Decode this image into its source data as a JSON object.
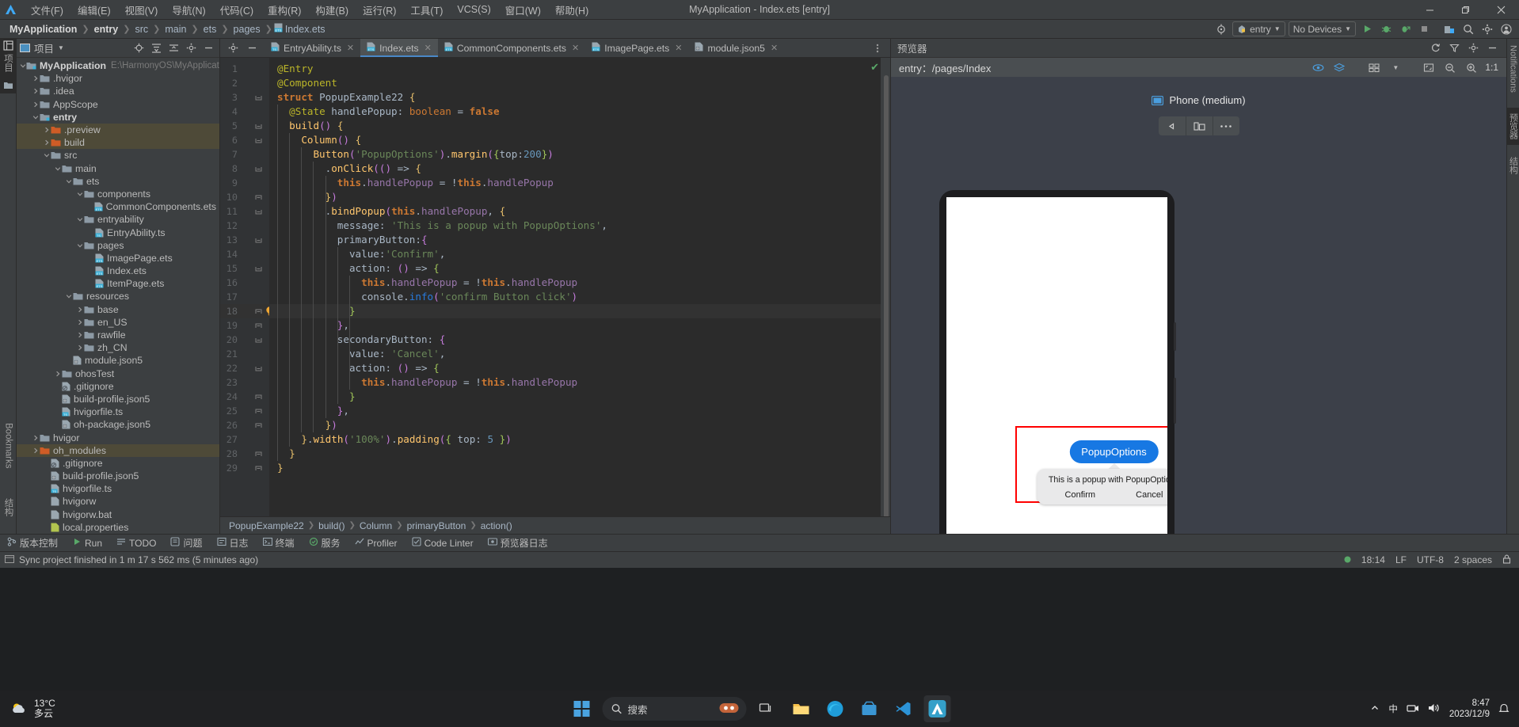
{
  "titlebar": {
    "window_title": "MyApplication - Index.ets [entry]",
    "menus": [
      "文件(F)",
      "编辑(E)",
      "视图(V)",
      "导航(N)",
      "代码(C)",
      "重构(R)",
      "构建(B)",
      "运行(R)",
      "工具(T)",
      "VCS(S)",
      "窗口(W)",
      "帮助(H)"
    ],
    "minimize": "—",
    "restore": "❐",
    "close": "✕"
  },
  "navbar": {
    "crumbs": [
      "MyApplication",
      "entry",
      "src",
      "main",
      "ets",
      "pages"
    ],
    "file": "Index.ets",
    "run_config": "entry",
    "device": "No Devices",
    "icons": [
      "target-icon",
      "run-icon",
      "debug-icon",
      "profile-icon",
      "stop-icon",
      "device-manager-icon",
      "search-icon",
      "settings-icon",
      "account-icon"
    ]
  },
  "left_strip": {
    "top_items": [
      "项目",
      "结构"
    ],
    "bottom_items": [
      "Bookmarks",
      "结构"
    ]
  },
  "project_panel": {
    "title": "项目",
    "header_icons": [
      "locate-icon",
      "expand-all-icon",
      "collapse-all-icon",
      "settings-icon",
      "hide-icon"
    ],
    "root_path": "E:\\HarmonyOS\\MyApplicatio",
    "tree": [
      {
        "label": "MyApplication",
        "depth": 0,
        "arrow": "down",
        "icon": "module-folder",
        "bold": true,
        "path": "E:\\HarmonyOS\\MyApplicatio"
      },
      {
        "label": ".hvigor",
        "depth": 1,
        "arrow": "right",
        "icon": "folder"
      },
      {
        "label": ".idea",
        "depth": 1,
        "arrow": "right",
        "icon": "folder"
      },
      {
        "label": "AppScope",
        "depth": 1,
        "arrow": "right",
        "icon": "folder"
      },
      {
        "label": "entry",
        "depth": 1,
        "arrow": "down",
        "icon": "module-folder",
        "bold": true
      },
      {
        "label": ".preview",
        "depth": 2,
        "arrow": "right",
        "icon": "folder-orange",
        "selected": true
      },
      {
        "label": "build",
        "depth": 2,
        "arrow": "right",
        "icon": "folder-orange",
        "selected": true
      },
      {
        "label": "src",
        "depth": 2,
        "arrow": "down",
        "icon": "folder"
      },
      {
        "label": "main",
        "depth": 3,
        "arrow": "down",
        "icon": "folder"
      },
      {
        "label": "ets",
        "depth": 4,
        "arrow": "down",
        "icon": "folder"
      },
      {
        "label": "components",
        "depth": 5,
        "arrow": "down",
        "icon": "folder"
      },
      {
        "label": "CommonComponents.ets",
        "depth": 6,
        "arrow": "",
        "icon": "ets-file"
      },
      {
        "label": "entryability",
        "depth": 5,
        "arrow": "down",
        "icon": "folder"
      },
      {
        "label": "EntryAbility.ts",
        "depth": 6,
        "arrow": "",
        "icon": "ts-file"
      },
      {
        "label": "pages",
        "depth": 5,
        "arrow": "down",
        "icon": "folder"
      },
      {
        "label": "ImagePage.ets",
        "depth": 6,
        "arrow": "",
        "icon": "ets-file"
      },
      {
        "label": "Index.ets",
        "depth": 6,
        "arrow": "",
        "icon": "ets-file"
      },
      {
        "label": "ItemPage.ets",
        "depth": 6,
        "arrow": "",
        "icon": "ets-file"
      },
      {
        "label": "resources",
        "depth": 4,
        "arrow": "down",
        "icon": "folder"
      },
      {
        "label": "base",
        "depth": 5,
        "arrow": "right",
        "icon": "folder"
      },
      {
        "label": "en_US",
        "depth": 5,
        "arrow": "right",
        "icon": "folder"
      },
      {
        "label": "rawfile",
        "depth": 5,
        "arrow": "right",
        "icon": "folder"
      },
      {
        "label": "zh_CN",
        "depth": 5,
        "arrow": "right",
        "icon": "folder"
      },
      {
        "label": "module.json5",
        "depth": 4,
        "arrow": "",
        "icon": "json-file"
      },
      {
        "label": "ohosTest",
        "depth": 3,
        "arrow": "right",
        "icon": "folder"
      },
      {
        "label": ".gitignore",
        "depth": 3,
        "arrow": "",
        "icon": "gitignore-file"
      },
      {
        "label": "build-profile.json5",
        "depth": 3,
        "arrow": "",
        "icon": "json-file"
      },
      {
        "label": "hvigorfile.ts",
        "depth": 3,
        "arrow": "",
        "icon": "ts-file"
      },
      {
        "label": "oh-package.json5",
        "depth": 3,
        "arrow": "",
        "icon": "json-file"
      },
      {
        "label": "hvigor",
        "depth": 1,
        "arrow": "right",
        "icon": "folder"
      },
      {
        "label": "oh_modules",
        "depth": 1,
        "arrow": "right",
        "icon": "folder-orange",
        "selected": true
      },
      {
        "label": ".gitignore",
        "depth": 2,
        "arrow": "",
        "icon": "gitignore-file"
      },
      {
        "label": "build-profile.json5",
        "depth": 2,
        "arrow": "",
        "icon": "json-file"
      },
      {
        "label": "hvigorfile.ts",
        "depth": 2,
        "arrow": "",
        "icon": "ts-file"
      },
      {
        "label": "hvigorw",
        "depth": 2,
        "arrow": "",
        "icon": "file"
      },
      {
        "label": "hvigorw.bat",
        "depth": 2,
        "arrow": "",
        "icon": "file"
      },
      {
        "label": "local.properties",
        "depth": 2,
        "arrow": "",
        "icon": "props-file"
      }
    ]
  },
  "editor": {
    "tabs": [
      {
        "label": "EntryAbility.ts",
        "icon": "ts-file",
        "active": false
      },
      {
        "label": "Index.ets",
        "icon": "ets-file",
        "active": true
      },
      {
        "label": "CommonComponents.ets",
        "icon": "ets-file",
        "active": false
      },
      {
        "label": "ImagePage.ets",
        "icon": "ets-file",
        "active": false
      },
      {
        "label": "module.json5",
        "icon": "json-file",
        "active": false
      }
    ],
    "highlighted_line": 18,
    "lines": [
      {
        "n": 1,
        "indent": 0,
        "fold": "",
        "tokens": [
          [
            "k-deco",
            "@Entry"
          ]
        ]
      },
      {
        "n": 2,
        "indent": 0,
        "fold": "",
        "tokens": [
          [
            "k-deco",
            "@Component"
          ]
        ]
      },
      {
        "n": 3,
        "indent": 0,
        "fold": "minus",
        "tokens": [
          [
            "k-kw",
            "struct "
          ],
          [
            "k-cls",
            "PopupExample22 "
          ],
          [
            "k-bracket1",
            "{"
          ]
        ]
      },
      {
        "n": 4,
        "indent": 1,
        "fold": "",
        "tokens": [
          [
            "k-deco",
            "@State "
          ],
          [
            "k-pl",
            "handlePopup"
          ],
          [
            "k-pl",
            ": "
          ],
          [
            "k-kw2",
            "boolean"
          ],
          [
            "k-pl",
            " = "
          ],
          [
            "k-kw",
            "false"
          ]
        ]
      },
      {
        "n": 5,
        "indent": 1,
        "fold": "minus",
        "tokens": [
          [
            "k-def",
            "build"
          ],
          [
            "k-bracket2",
            "()"
          ],
          [
            "k-pl",
            " "
          ],
          [
            "k-bracket1",
            "{"
          ]
        ]
      },
      {
        "n": 6,
        "indent": 2,
        "fold": "minus",
        "tokens": [
          [
            "k-fn",
            "Column"
          ],
          [
            "k-bracket2",
            "()"
          ],
          [
            "k-pl",
            " "
          ],
          [
            "k-bracket1",
            "{"
          ]
        ]
      },
      {
        "n": 7,
        "indent": 3,
        "fold": "",
        "tokens": [
          [
            "k-fn",
            "Button"
          ],
          [
            "k-bracket2",
            "("
          ],
          [
            "k-str",
            "'PopupOptions'"
          ],
          [
            "k-bracket2",
            ")"
          ],
          [
            "k-pl",
            "."
          ],
          [
            "k-fn",
            "margin"
          ],
          [
            "k-bracket2",
            "("
          ],
          [
            "k-bracket3",
            "{"
          ],
          [
            "k-pl",
            "top:"
          ],
          [
            "k-num",
            "200"
          ],
          [
            "k-bracket3",
            "}"
          ],
          [
            "k-bracket2",
            ")"
          ]
        ]
      },
      {
        "n": 8,
        "indent": 4,
        "fold": "minus",
        "tokens": [
          [
            "k-pl",
            "."
          ],
          [
            "k-fn",
            "onClick"
          ],
          [
            "k-bracket2",
            "(("
          ],
          [
            "k-bracket2",
            ")"
          ],
          [
            "k-pl",
            " => "
          ],
          [
            "k-bracket1",
            "{"
          ]
        ]
      },
      {
        "n": 9,
        "indent": 5,
        "fold": "",
        "tokens": [
          [
            "k-kw",
            "this"
          ],
          [
            "k-pl",
            "."
          ],
          [
            "k-field",
            "handlePopup"
          ],
          [
            "k-pl",
            " = !"
          ],
          [
            "k-kw",
            "this"
          ],
          [
            "k-pl",
            "."
          ],
          [
            "k-field",
            "handlePopup"
          ]
        ]
      },
      {
        "n": 10,
        "indent": 4,
        "fold": "minus-end",
        "tokens": [
          [
            "k-bracket1",
            "}"
          ],
          [
            "k-bracket2",
            ")"
          ]
        ]
      },
      {
        "n": 11,
        "indent": 4,
        "fold": "minus",
        "tokens": [
          [
            "k-pl",
            "."
          ],
          [
            "k-fn",
            "bindPopup"
          ],
          [
            "k-bracket2",
            "("
          ],
          [
            "k-kw",
            "this"
          ],
          [
            "k-pl",
            "."
          ],
          [
            "k-field",
            "handlePopup"
          ],
          [
            "k-pl",
            ", "
          ],
          [
            "k-bracket1",
            "{"
          ]
        ]
      },
      {
        "n": 12,
        "indent": 5,
        "fold": "",
        "tokens": [
          [
            "k-pl",
            "message: "
          ],
          [
            "k-str",
            "'This is a popup with PopupOptions'"
          ],
          [
            "k-pl",
            ","
          ]
        ]
      },
      {
        "n": 13,
        "indent": 5,
        "fold": "minus",
        "tokens": [
          [
            "k-pl",
            "primaryButton:"
          ],
          [
            "k-bracket2",
            "{"
          ]
        ]
      },
      {
        "n": 14,
        "indent": 6,
        "fold": "",
        "tokens": [
          [
            "k-pl",
            "value:"
          ],
          [
            "k-str",
            "'Confirm'"
          ],
          [
            "k-pl",
            ","
          ]
        ]
      },
      {
        "n": 15,
        "indent": 6,
        "fold": "minus",
        "tokens": [
          [
            "k-pl",
            "action: "
          ],
          [
            "k-bracket2",
            "()"
          ],
          [
            "k-pl",
            " => "
          ],
          [
            "k-bracket3",
            "{"
          ]
        ]
      },
      {
        "n": 16,
        "indent": 7,
        "fold": "",
        "tokens": [
          [
            "k-kw",
            "this"
          ],
          [
            "k-pl",
            "."
          ],
          [
            "k-field",
            "handlePopup"
          ],
          [
            "k-pl",
            " = !"
          ],
          [
            "k-kw",
            "this"
          ],
          [
            "k-pl",
            "."
          ],
          [
            "k-field",
            "handlePopup"
          ]
        ]
      },
      {
        "n": 17,
        "indent": 7,
        "fold": "",
        "tokens": [
          [
            "k-pl",
            "console."
          ],
          [
            "k-blue",
            "info"
          ],
          [
            "k-bracket2",
            "("
          ],
          [
            "k-str",
            "'confirm Button click'"
          ],
          [
            "k-bracket2",
            ")"
          ]
        ]
      },
      {
        "n": 18,
        "indent": 6,
        "fold": "minus-end",
        "tokens": [
          [
            "k-bracket3",
            "}"
          ]
        ]
      },
      {
        "n": 19,
        "indent": 5,
        "fold": "minus-end",
        "tokens": [
          [
            "k-bracket2",
            "}"
          ],
          [
            "k-pl",
            ","
          ]
        ]
      },
      {
        "n": 20,
        "indent": 5,
        "fold": "minus",
        "tokens": [
          [
            "k-pl",
            "secondaryButton: "
          ],
          [
            "k-bracket2",
            "{"
          ]
        ]
      },
      {
        "n": 21,
        "indent": 6,
        "fold": "",
        "tokens": [
          [
            "k-pl",
            "value: "
          ],
          [
            "k-str",
            "'Cancel'"
          ],
          [
            "k-pl",
            ","
          ]
        ]
      },
      {
        "n": 22,
        "indent": 6,
        "fold": "minus",
        "tokens": [
          [
            "k-pl",
            "action: "
          ],
          [
            "k-bracket2",
            "()"
          ],
          [
            "k-pl",
            " => "
          ],
          [
            "k-bracket3",
            "{"
          ]
        ]
      },
      {
        "n": 23,
        "indent": 7,
        "fold": "",
        "tokens": [
          [
            "k-kw",
            "this"
          ],
          [
            "k-pl",
            "."
          ],
          [
            "k-field",
            "handlePopup"
          ],
          [
            "k-pl",
            " = !"
          ],
          [
            "k-kw",
            "this"
          ],
          [
            "k-pl",
            "."
          ],
          [
            "k-field",
            "handlePopup"
          ]
        ]
      },
      {
        "n": 24,
        "indent": 6,
        "fold": "minus-end",
        "tokens": [
          [
            "k-bracket3",
            "}"
          ]
        ]
      },
      {
        "n": 25,
        "indent": 5,
        "fold": "minus-end",
        "tokens": [
          [
            "k-bracket2",
            "}"
          ],
          [
            "k-pl",
            ","
          ]
        ]
      },
      {
        "n": 26,
        "indent": 4,
        "fold": "minus-end",
        "tokens": [
          [
            "k-bracket1",
            "}"
          ],
          [
            "k-bracket2",
            ")"
          ]
        ]
      },
      {
        "n": 27,
        "indent": 2,
        "fold": "",
        "tokens": [
          [
            "k-bracket1",
            "}"
          ],
          [
            "k-pl",
            "."
          ],
          [
            "k-fn",
            "width"
          ],
          [
            "k-bracket2",
            "("
          ],
          [
            "k-str",
            "'100%'"
          ],
          [
            "k-bracket2",
            ")"
          ],
          [
            "k-pl",
            "."
          ],
          [
            "k-fn",
            "padding"
          ],
          [
            "k-bracket2",
            "("
          ],
          [
            "k-bracket3",
            "{ "
          ],
          [
            "k-pl",
            "top: "
          ],
          [
            "k-num",
            "5"
          ],
          [
            "k-bracket3",
            " }"
          ],
          [
            "k-bracket2",
            ")"
          ]
        ]
      },
      {
        "n": 28,
        "indent": 1,
        "fold": "minus-end",
        "tokens": [
          [
            "k-bracket1",
            "}"
          ]
        ]
      },
      {
        "n": 29,
        "indent": 0,
        "fold": "minus-end",
        "tokens": [
          [
            "k-bracket1",
            "}"
          ]
        ]
      }
    ],
    "breadcrumb": [
      "PopupExample22",
      "build()",
      "Column",
      "primaryButton",
      "action()"
    ]
  },
  "preview": {
    "title": "预览器",
    "route": "entry：/pages/Index",
    "device_label": "Phone (medium)",
    "zoom_label": "1:1",
    "header_icons": [
      "eye-icon",
      "layers-icon"
    ],
    "toolbar_icons": [
      "grid-icon",
      "dropdown-icon",
      "fit-icon",
      "zoom-out-icon",
      "zoom-in-icon",
      "reset-icon"
    ],
    "device_ctrls": [
      "rotate-left-icon",
      "multi-device-icon",
      "more-icon"
    ],
    "popup": {
      "button_label": "PopupOptions",
      "message": "This is a popup with PopupOptions",
      "primary": "Confirm",
      "secondary": "Cancel"
    },
    "right_strip": [
      "Notifications",
      "预览器",
      "结构"
    ]
  },
  "toolwindows": [
    {
      "label": "版本控制",
      "icon": "vcs-icon"
    },
    {
      "label": "Run",
      "icon": "run-icon"
    },
    {
      "label": "TODO",
      "icon": "todo-icon"
    },
    {
      "label": "问题",
      "icon": "problems-icon"
    },
    {
      "label": "日志",
      "icon": "log-icon"
    },
    {
      "label": "终端",
      "icon": "terminal-icon"
    },
    {
      "label": "服务",
      "icon": "services-icon"
    },
    {
      "label": "Profiler",
      "icon": "profiler-icon"
    },
    {
      "label": "Code Linter",
      "icon": "linter-icon"
    },
    {
      "label": "预览器日志",
      "icon": "preview-log-icon"
    }
  ],
  "statusbar": {
    "message": "Sync project finished in 1 m 17 s 562 ms (5 minutes ago)",
    "time": "18:14",
    "line_sep": "LF",
    "encoding": "UTF-8",
    "indent": "2 spaces"
  },
  "taskbar": {
    "weather_temp": "13°C",
    "weather_desc": "多云",
    "search_placeholder": "搜索",
    "clock_time": "8:47",
    "clock_date": "2023/12/9",
    "lang": "中",
    "icons": [
      "start-icon",
      "search-icon",
      "copilot-icon",
      "taskview-icon",
      "explorer-icon",
      "edge-icon",
      "store-icon",
      "vscode-icon",
      "deveco-icon"
    ]
  }
}
